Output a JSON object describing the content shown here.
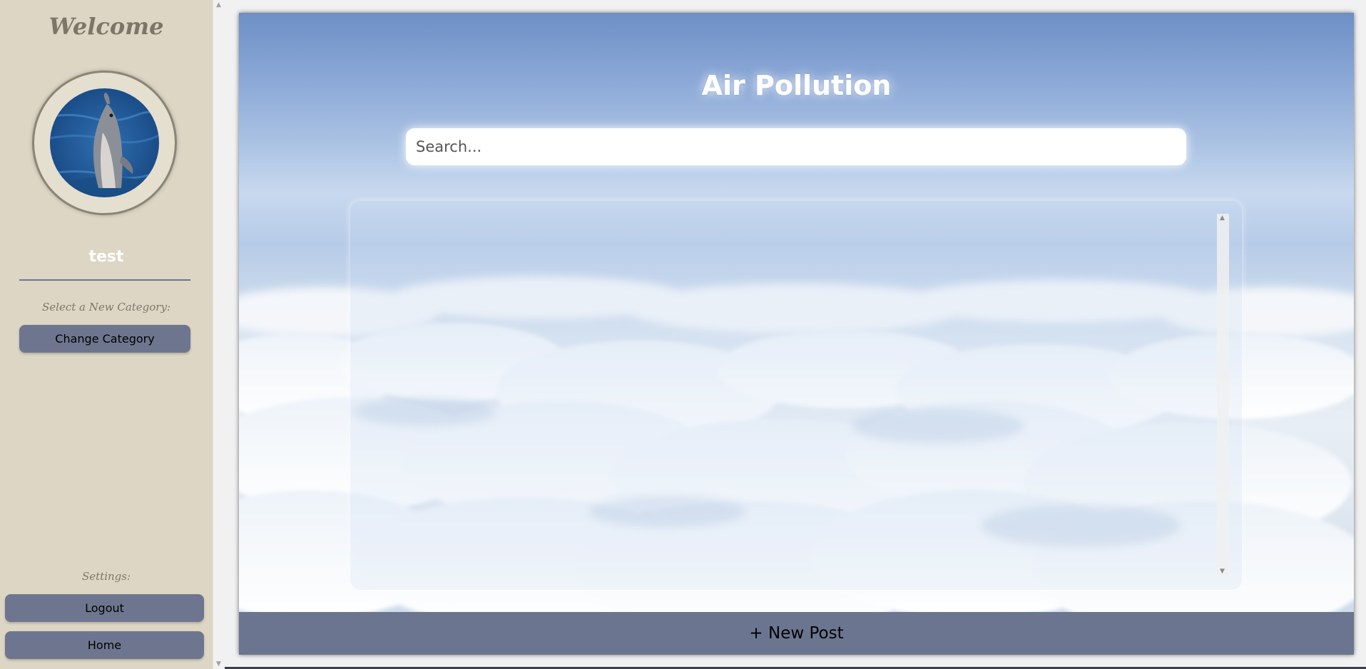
{
  "sidebar": {
    "welcome": "Welcome",
    "username": "test",
    "category_label": "Select a New Category:",
    "change_category_label": "Change Category",
    "settings_label": "Settings:",
    "logout_label": "Logout",
    "home_label": "Home",
    "avatar_icon": "dolphin-avatar"
  },
  "main": {
    "title": "Air Pollution",
    "search_placeholder": "Search...",
    "new_post_label": "+ New Post",
    "background": "sky-clouds-image"
  },
  "colors": {
    "sidebar_bg": "#ddd6c5",
    "button_bg": "#6e768f",
    "new_post_bg": "#6c758f"
  }
}
